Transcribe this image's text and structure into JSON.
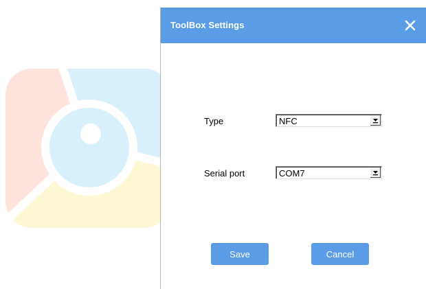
{
  "dialog": {
    "title": "ToolBox Settings",
    "close_icon": "close-icon"
  },
  "form": {
    "type": {
      "label": "Type",
      "selected": "NFC"
    },
    "serial_port": {
      "label": "Serial port",
      "selected": "COM7"
    }
  },
  "buttons": {
    "save_label": "Save",
    "cancel_label": "Cancel"
  },
  "colors": {
    "accent": "#5b9ce6",
    "background": "#ffffff"
  },
  "watermark": {
    "icon": "camera-lens-logo-icon"
  }
}
